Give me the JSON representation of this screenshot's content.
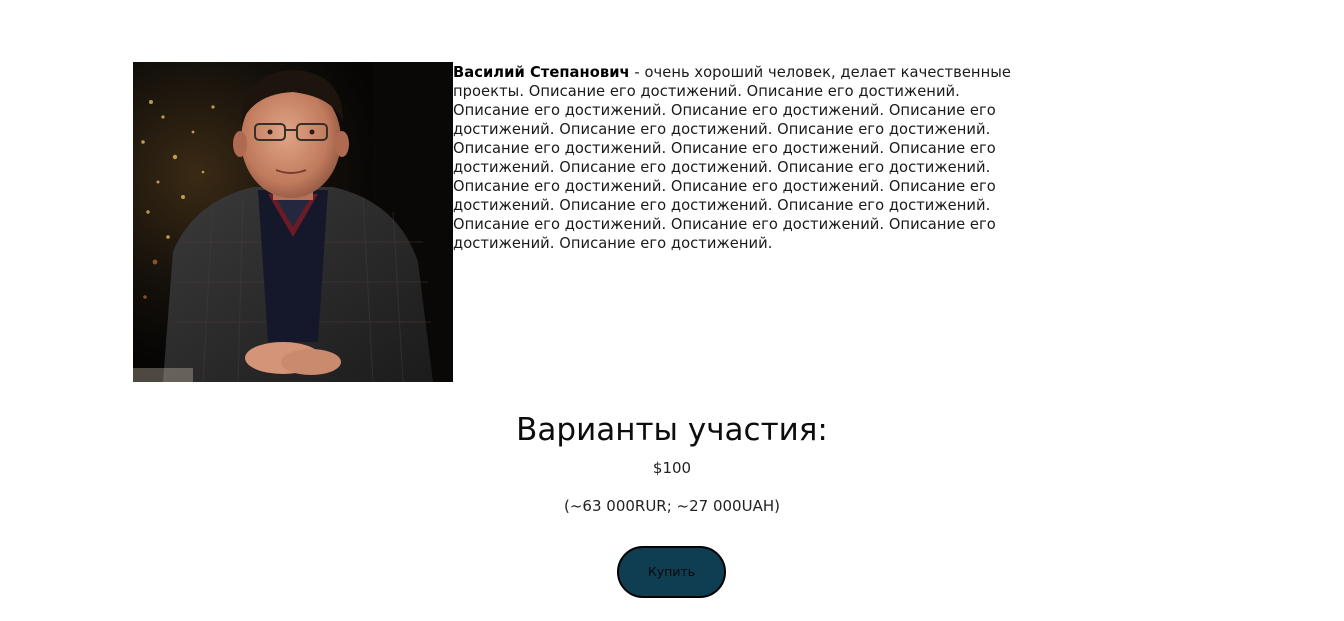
{
  "speaker": {
    "name": "Василий Степанович",
    "bio": " - очень хороший человек, делает качественные проекты. Описание его достижений. Описание его достижений. Описание его достижений. Описание его достижений. Описание его достижений. Описание его достижений. Описание его достижений. Описание его достижений. Описание его достижений. Описание его достижений. Описание его достижений. Описание его достижений. Описание его достижений. Описание его достижений. Описание его достижений. Описание его достижений. Описание его достижений. Описание его достижений. Описание его достижений. Описание его достижений. Описание его достижений."
  },
  "participation": {
    "title": "Варианты участия:",
    "price": "$100",
    "conversion": "(~63 000RUR; ~27 000UAH)",
    "buy_label": "Купить"
  },
  "colors": {
    "button_bg": "#0f3e52",
    "text": "#111111"
  }
}
